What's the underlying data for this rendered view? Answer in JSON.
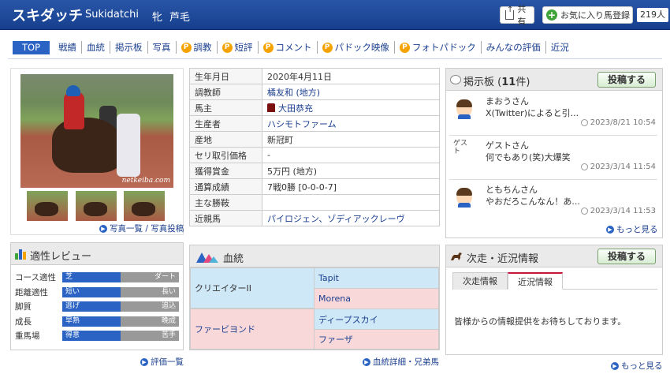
{
  "header": {
    "title": "スキダッチ",
    "romaji": "Sukidatchi",
    "sex": "牝",
    "coat": "芦毛",
    "share_label": "共有",
    "fav_label": "お気に入り馬登録",
    "fav_count": "219人"
  },
  "tabs": [
    {
      "label": "TOP",
      "premium": false
    },
    {
      "label": "戦績",
      "premium": false
    },
    {
      "label": "血統",
      "premium": false
    },
    {
      "label": "掲示板",
      "premium": false
    },
    {
      "label": "写真",
      "premium": false
    },
    {
      "label": "調教",
      "premium": true
    },
    {
      "label": "短評",
      "premium": true
    },
    {
      "label": "コメント",
      "premium": true
    },
    {
      "label": "パドック映像",
      "premium": true
    },
    {
      "label": "フォトパドック",
      "premium": true
    },
    {
      "label": "みんなの評価",
      "premium": false
    },
    {
      "label": "近況",
      "premium": false
    }
  ],
  "premium_mark": "P",
  "photo": {
    "watermark": "netkeiba.com",
    "links": "写真一覧 / 写真投稿"
  },
  "profile": [
    {
      "key": "生年月日",
      "value": "2020年4月11日"
    },
    {
      "key": "調教師",
      "value": "橘友和 (地方)"
    },
    {
      "key": "馬主",
      "value": "大田恭充"
    },
    {
      "key": "生産者",
      "value": "ハシモトファーム"
    },
    {
      "key": "産地",
      "value": "新冠町"
    },
    {
      "key": "セリ取引価格",
      "value": "-"
    },
    {
      "key": "獲得賞金",
      "value": "5万円 (地方)"
    },
    {
      "key": "通算成績",
      "value": "7戦0勝 [0-0-0-7]"
    },
    {
      "key": "主な勝鞍",
      "value": ""
    },
    {
      "key": "近親馬",
      "value": "パイロジェン、ゾディアックレーヴ"
    }
  ],
  "bbs": {
    "title": "掲示板 (11件)",
    "title_pre": "掲示板 (",
    "count": "11",
    "title_post": "件)",
    "post_button": "投稿する",
    "posts": [
      {
        "name": "まおうさん",
        "text": "X(Twitter)によると引...",
        "time": "2023/8/21 10:54"
      },
      {
        "name": "ゲストさん",
        "text": "何でもあり(笑)大爆笑",
        "time": "2023/3/14 11:54",
        "avatar_alt": "ゲスト"
      },
      {
        "name": "ともちんさん",
        "text": "やおだろこんなん！あ...",
        "time": "2023/3/14 11:53"
      }
    ],
    "more": "もっと見る"
  },
  "aptitude": {
    "title": "適性レビュー",
    "rows": [
      {
        "label": "コース適性",
        "left": "芝",
        "right": "ダート",
        "fill": 0.5
      },
      {
        "label": "距離適性",
        "left": "短い",
        "right": "長い",
        "fill": 0.5
      },
      {
        "label": "脚質",
        "left": "逃げ",
        "right": "追込",
        "fill": 0.5
      },
      {
        "label": "成長",
        "left": "早熟",
        "right": "晩成",
        "fill": 0.5
      },
      {
        "label": "重馬場",
        "left": "得意",
        "right": "苦手",
        "fill": 0.5
      }
    ],
    "link": "評価一覧"
  },
  "pedigree": {
    "title": "血統",
    "sire": "クリエイターII",
    "sire_sire": "Tapit",
    "sire_dam": "Morena",
    "dam": "ファービヨンド",
    "dam_sire": "ディープスカイ",
    "dam_dam": "ファーザ",
    "link": "血統詳細・兄弟馬"
  },
  "next": {
    "title": "次走・近況情報",
    "post_button": "投稿する",
    "tab_next": "次走情報",
    "tab_recent": "近況情報",
    "message": "皆様からの情報提供をお待ちしております。",
    "more": "もっと見る"
  },
  "colors": {
    "header_blue": "#1e4a9c",
    "active_tab": "#2a63c4",
    "premium": "#f5a300",
    "link": "#1b3f8f",
    "pedigree_male": "#cfe8f8",
    "pedigree_female": "#f9d8da"
  }
}
